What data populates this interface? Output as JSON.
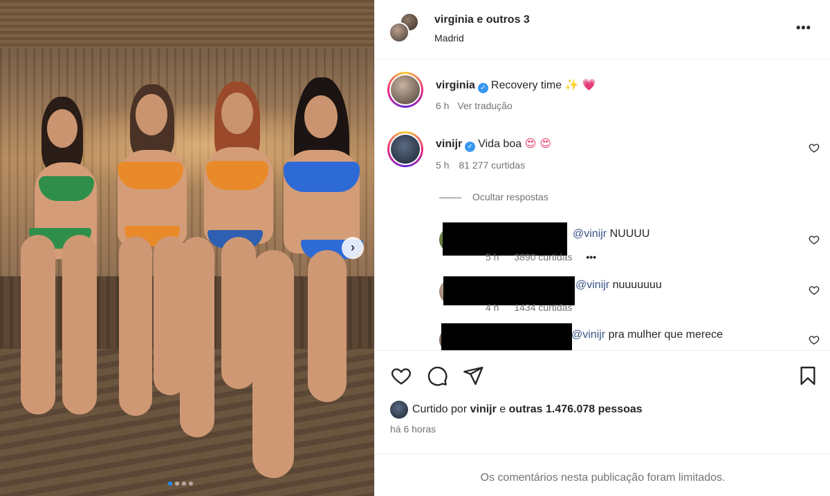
{
  "header": {
    "title_user": "virginia",
    "title_rest": "e outros 3",
    "location": "Madrid",
    "more_icon": "more-horizontal-icon"
  },
  "caption": {
    "username": "virginia",
    "text": "Recovery time",
    "emojis": "✨ 💗",
    "time": "6 h",
    "translate": "Ver tradução"
  },
  "comments": [
    {
      "username": "vinijr",
      "text": "Vida boa",
      "emojis": "😍 😍",
      "time": "5 h",
      "likes": "81 277 curtidas"
    }
  ],
  "replies_toggle": "Ocultar respostas",
  "replies": [
    {
      "mention": "@vinijr",
      "text": "NUUUU",
      "time": "5 h",
      "likes": "3890 curtidas",
      "more": "•••"
    },
    {
      "mention": "@vinijr",
      "text": "nuuuuuuu",
      "time": "4 h",
      "likes": "1434 curtidas"
    },
    {
      "mention": "@vinijr",
      "text": "pra mulher que merece"
    }
  ],
  "actions": {
    "like_icon": "heart-icon",
    "comment_icon": "comment-icon",
    "share_icon": "send-icon",
    "save_icon": "bookmark-icon"
  },
  "likes_line": {
    "prefix": "Curtido por",
    "user": "vinijr",
    "conj": "e",
    "others": "outras 1.476.078 pessoas"
  },
  "post_time": "há 6 horas",
  "comments_limited": "Os comentários nesta publicação foram limitados.",
  "carousel": {
    "current": 1,
    "total": 4
  },
  "colors": {
    "verified": "#3897f0",
    "mention": "#385185",
    "muted": "#737373",
    "carousel_active": "#1e90ff"
  }
}
